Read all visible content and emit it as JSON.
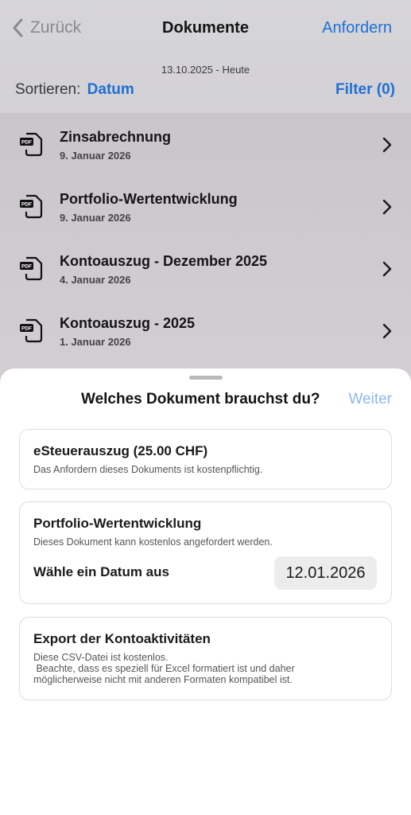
{
  "nav": {
    "back_label": "Zurück",
    "title": "Dokumente",
    "action_label": "Anfordern"
  },
  "date_caption": "13.10.2025 - Heute",
  "sort": {
    "label": "Sortieren:",
    "value": "Datum",
    "filter_label": "Filter (0)"
  },
  "documents": [
    {
      "icon": "pdf-file-icon",
      "title": "Zinsabrechnung",
      "date": "9. Januar 2026"
    },
    {
      "icon": "pdf-file-icon",
      "title": "Portfolio-Wertentwicklung",
      "date": "9. Januar 2026"
    },
    {
      "icon": "pdf-file-icon",
      "title": "Kontoauszug - Dezember 2025",
      "date": "4. Januar 2026"
    },
    {
      "icon": "pdf-file-icon",
      "title": "Kontoauszug - 2025",
      "date": "1. Januar 2026"
    }
  ],
  "sheet": {
    "title": "Welches Dokument brauchst du?",
    "next_label": "Weiter",
    "options": [
      {
        "title": "eSteuerauszug (25.00 CHF)",
        "description": "Das Anfordern dieses Dokuments ist kostenpflichtig."
      },
      {
        "title": "Portfolio-Wertentwicklung",
        "description": "Dieses Dokument kann kostenlos angefordert werden.",
        "date_label": "Wähle ein Datum aus",
        "date_value": "12.01.2026"
      },
      {
        "title": "Export der Kontoaktivitäten",
        "description_lines": [
          "Diese CSV-Datei ist kostenlos.",
          " Beachte, dass es speziell für Excel formatiert ist und daher",
          "möglicherweise nicht mit anderen Formaten kompatibel ist."
        ]
      }
    ]
  },
  "colors": {
    "accent": "#1f6fd6",
    "accent_disabled": "#8cb8ec",
    "dim_background": "#d1cfd3"
  }
}
